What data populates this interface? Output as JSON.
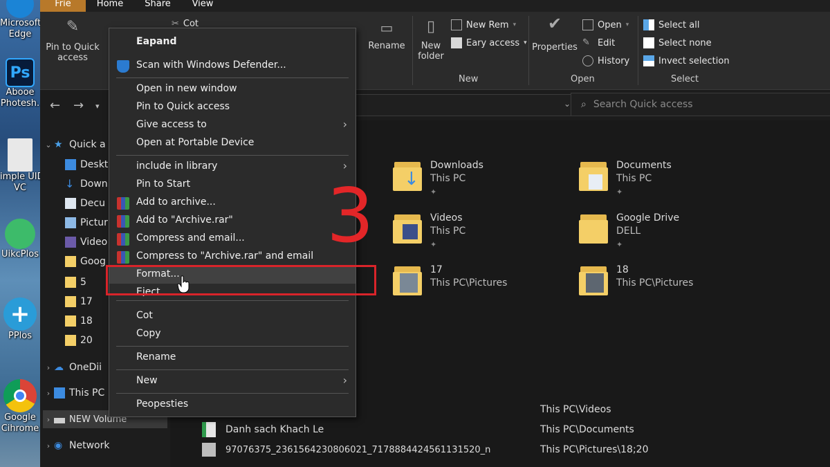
{
  "desktop": {
    "icons": [
      {
        "label1": "Microsoft",
        "label2": "Edge"
      },
      {
        "label1": "Abooe",
        "label2": "Photesh."
      },
      {
        "label1": "imple UID",
        "label2": "VC"
      },
      {
        "label1": "UikcPlos",
        "label2": ""
      },
      {
        "label1": "PPlos",
        "label2": ""
      },
      {
        "label1": "Google",
        "label2": "Cihrome"
      }
    ],
    "ps_glyph": "Ps"
  },
  "ribbon": {
    "tabs": [
      "Frie",
      "Home",
      "Share",
      "View"
    ],
    "pin_quick_access": "Pin to Quick access",
    "cut": "Cot",
    "rename": "Rename",
    "new_folder": "New folder",
    "new_item": "New Rem",
    "easy_access": "Eary access",
    "properties": "Properties",
    "open": "Open",
    "edit": "Edit",
    "history": "History",
    "select_all": "Select all",
    "select_none": "Select none",
    "invert_selection": "Invect selection",
    "group_new": "New",
    "group_open": "Open",
    "group_select": "Select"
  },
  "search": {
    "placeholder": "Search Quick access"
  },
  "navpane": {
    "quick_access": "Quick a",
    "items": [
      "Deskt",
      "Down",
      "Decu",
      "Pictur",
      "Video",
      "Goog",
      "5",
      "17",
      "18",
      "20"
    ],
    "onedrive": "OneDii",
    "this_pc": "This PC",
    "new_volume": "NEW Volume",
    "network": "Network"
  },
  "folders": [
    {
      "name": "Downloads",
      "location": "This PC"
    },
    {
      "name": "Documents",
      "location": "This PC"
    },
    {
      "name": "Videos",
      "location": "This PC"
    },
    {
      "name": "Google Drive",
      "location": "DELL"
    },
    {
      "name": "17",
      "location": "This PC\\Pictures"
    },
    {
      "name": "18",
      "location": "This PC\\Pictures"
    }
  ],
  "recent_files": [
    {
      "name": "",
      "location": "This PC\\Videos"
    },
    {
      "name": "Danh sach Khach Le",
      "location": "This PC\\Documents"
    },
    {
      "name": "97076375_2361564230806021_7178884424561131520_n",
      "location": "This PC\\Pictures\\18;20"
    }
  ],
  "context_menu": {
    "expand": "Eapand",
    "scan": "Scan with Windows Defender...",
    "open_new_window": "Open in new window",
    "pin_quick_access": "Pin to Quick access",
    "give_access": "Give access to",
    "open_portable": "Open at Portable Device",
    "include_library": "include in library",
    "pin_start": "Pin to Start",
    "add_archive": "Add to archive...",
    "add_archive_rar": "Add to \"Archive.rar\"",
    "compress_email": "Compress and email...",
    "compress_rar_email": "Compress to \"Archive.rar\" and email",
    "format": "Format...",
    "eject": "Eject",
    "cut": "Cot",
    "copy": "Copy",
    "rename": "Rename",
    "new": "New",
    "properties": "Peopesties"
  },
  "annotation": {
    "step": "3",
    "color": "#e32628"
  }
}
